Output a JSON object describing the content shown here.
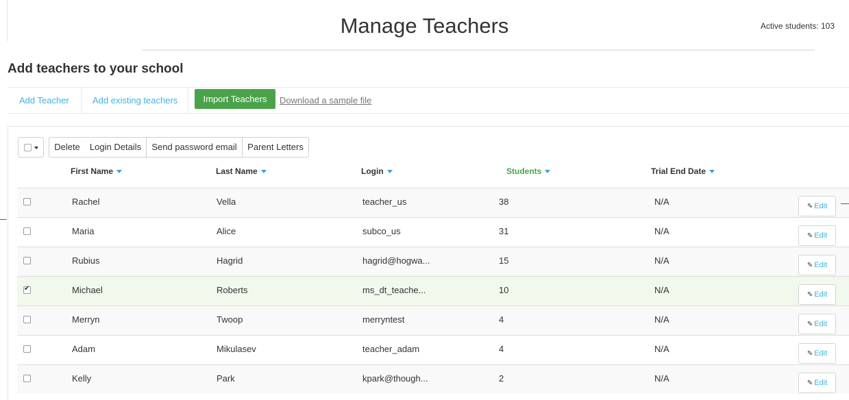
{
  "header": {
    "title": "Manage Teachers",
    "active_students": "Active students: 103"
  },
  "section": {
    "heading": "Add teachers to your school"
  },
  "tabs": {
    "add_teacher": "Add Teacher",
    "add_existing": "Add existing teachers",
    "import": "Import Teachers",
    "download_sample": "Download a sample file"
  },
  "actions": {
    "delete": "Delete",
    "login_details": "Login Details",
    "send_password": "Send password email",
    "parent_letters": "Parent Letters"
  },
  "columns": {
    "first_name": "First Name",
    "last_name": "Last Name",
    "login": "Login",
    "students": "Students",
    "trial_end": "Trial End Date"
  },
  "edit_label": "Edit",
  "rows": [
    {
      "first": "Rachel",
      "last": "Vella",
      "login": "teacher_us",
      "students": "38",
      "trial": "N/A",
      "checked": false
    },
    {
      "first": "Maria",
      "last": "Alice",
      "login": "subco_us",
      "students": "31",
      "trial": "N/A",
      "checked": false
    },
    {
      "first": "Rubius",
      "last": "Hagrid",
      "login": "hagrid@hogwa...",
      "students": "15",
      "trial": "N/A",
      "checked": false
    },
    {
      "first": "Michael",
      "last": "Roberts",
      "login": "ms_dt_teache...",
      "students": "10",
      "trial": "N/A",
      "checked": true
    },
    {
      "first": "Merryn",
      "last": "Twoop",
      "login": "merryntest",
      "students": "4",
      "trial": "N/A",
      "checked": false
    },
    {
      "first": "Adam",
      "last": "Mikulasev",
      "login": "teacher_adam",
      "students": "4",
      "trial": "N/A",
      "checked": false
    },
    {
      "first": "Kelly",
      "last": "Park",
      "login": "kpark@though...",
      "students": "2",
      "trial": "N/A",
      "checked": false
    }
  ],
  "colors": {
    "accent_green": "#4aa34a",
    "link_blue": "#3bb4e5",
    "caret_blue": "#3a9fd6"
  }
}
